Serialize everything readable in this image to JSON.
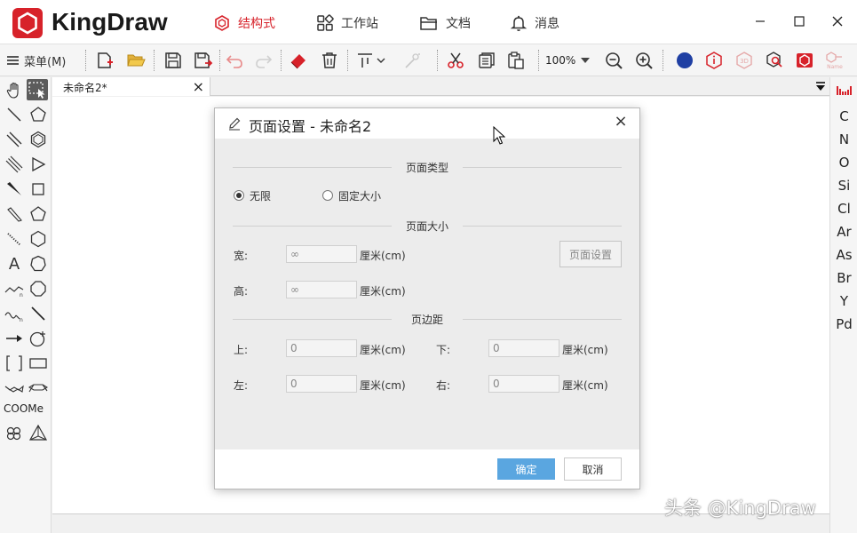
{
  "app": {
    "title": "KingDraw",
    "nav_tabs": [
      {
        "label": "结构式",
        "active": true
      },
      {
        "label": "工作站",
        "active": false
      },
      {
        "label": "文档",
        "active": false
      },
      {
        "label": "消息",
        "active": false
      }
    ]
  },
  "toolbar": {
    "menu_label": "菜单(M)",
    "zoom": "100%",
    "accent_color": "#d7222a"
  },
  "document": {
    "tab_label": "未命名2*",
    "tab_close": "×"
  },
  "left_palette": {
    "text_tools": [
      "A",
      "COOMe"
    ]
  },
  "right_palette": {
    "elements": [
      "C",
      "N",
      "O",
      "Si",
      "Cl",
      "Ar",
      "As",
      "Br",
      "Y",
      "Pd"
    ]
  },
  "dialog": {
    "title": "页面设置 - 未命名2",
    "close": "×",
    "section_page_type": "页面类型",
    "option_unlimited": "无限",
    "option_fixed": "固定大小",
    "selected_option": "无限",
    "section_page_size": "页面大小",
    "width_label": "宽:",
    "width_value": "∞",
    "height_label": "高:",
    "height_value": "∞",
    "unit": "厘米(cm)",
    "page_settings_button": "页面设置",
    "section_margin": "页边距",
    "top_label": "上:",
    "top_value": "0",
    "bottom_label": "下:",
    "bottom_value": "0",
    "left_label": "左:",
    "left_value": "0",
    "right_label": "右:",
    "right_value": "0",
    "ok": "确定",
    "cancel": "取消"
  },
  "watermark": "头条 @KingDraw"
}
